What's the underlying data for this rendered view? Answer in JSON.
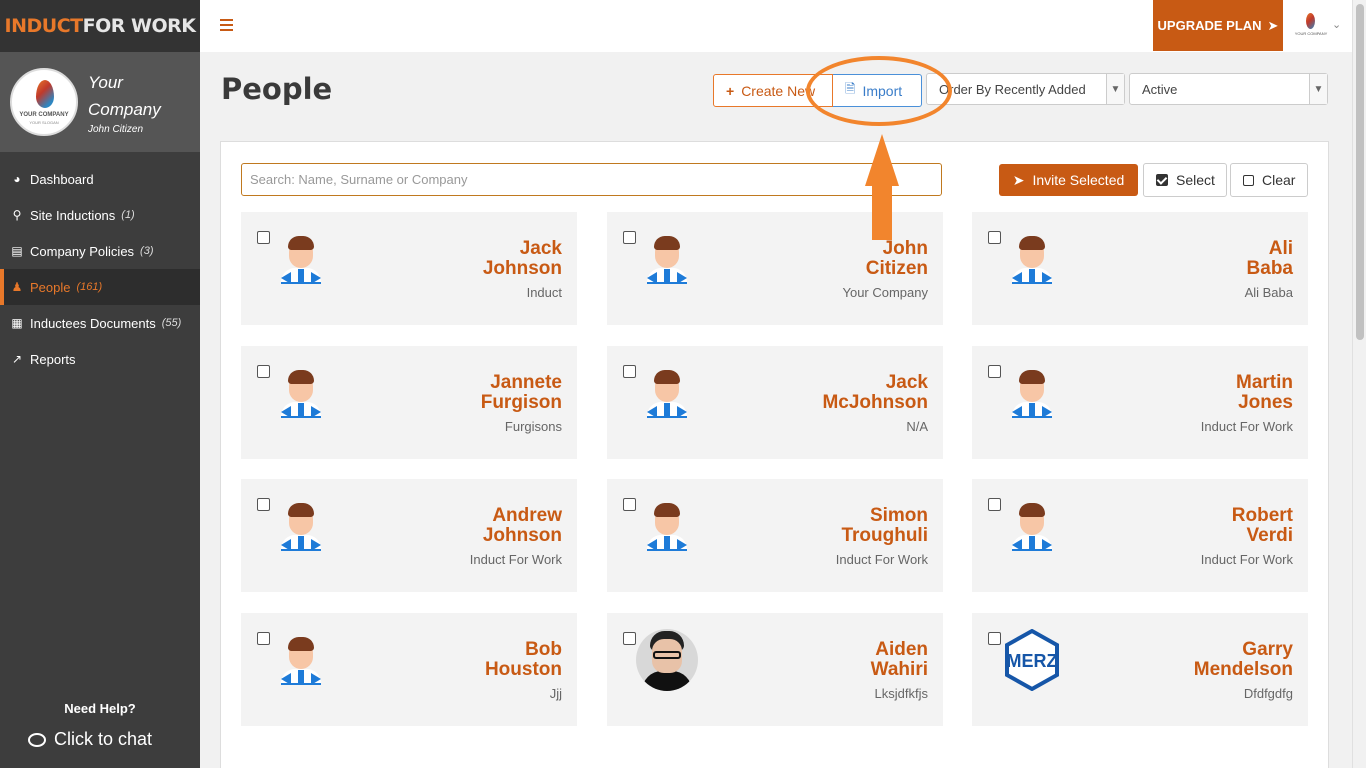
{
  "brand": {
    "part1": "INDUCT",
    "part2": "FOR WORK"
  },
  "profile": {
    "company": "Your Company",
    "user": "John Citizen",
    "logo_text": "YOUR COMPANY",
    "logo_sub": "YOUR SLOGAN"
  },
  "sidebar": {
    "items": [
      {
        "label": "Dashboard",
        "count": "",
        "icon": "dashboard-icon"
      },
      {
        "label": "Site Inductions",
        "count": "(1)",
        "icon": "map-marker-icon"
      },
      {
        "label": "Company Policies",
        "count": "(3)",
        "icon": "book-icon"
      },
      {
        "label": "People",
        "count": "(161)",
        "icon": "users-icon"
      },
      {
        "label": "Inductees Documents",
        "count": "(55)",
        "icon": "document-icon"
      },
      {
        "label": "Reports",
        "count": "",
        "icon": "chart-icon"
      }
    ],
    "help": "Need Help?",
    "chat": "Click to chat"
  },
  "topbar": {
    "upgrade": "UPGRADE PLAN"
  },
  "header": {
    "title": "People",
    "create": "Create New",
    "import": "Import",
    "order_by": "Order By Recently Added",
    "status": "Active"
  },
  "toolbar": {
    "search_placeholder": "Search: Name, Surname or Company",
    "invite": "Invite Selected",
    "select": "Select",
    "clear": "Clear"
  },
  "colors": {
    "accent": "#c85a14",
    "sidebar": "#3d3d3d",
    "annotation": "#f2852d"
  },
  "people": [
    {
      "first": "Jack",
      "last": "Johnson",
      "company": "Induct",
      "avatar": "default"
    },
    {
      "first": "John",
      "last": "Citizen",
      "company": "Your Company",
      "avatar": "default"
    },
    {
      "first": "Ali",
      "last": "Baba",
      "company": "Ali Baba",
      "avatar": "default"
    },
    {
      "first": "Jannete",
      "last": "Furgison",
      "company": "Furgisons",
      "avatar": "default"
    },
    {
      "first": "Jack",
      "last": "McJohnson",
      "company": "N/A",
      "avatar": "default"
    },
    {
      "first": "Martin",
      "last": "Jones",
      "company": "Induct For Work",
      "avatar": "default"
    },
    {
      "first": "Andrew",
      "last": "Johnson",
      "company": "Induct For Work",
      "avatar": "default"
    },
    {
      "first": "Simon",
      "last": "Troughuli",
      "company": "Induct For Work",
      "avatar": "default"
    },
    {
      "first": "Robert",
      "last": "Verdi",
      "company": "Induct For Work",
      "avatar": "default"
    },
    {
      "first": "Bob",
      "last": "Houston",
      "company": "Jjj",
      "avatar": "default"
    },
    {
      "first": "Aiden",
      "last": "Wahiri",
      "company": "Lksjdfkfjs",
      "avatar": "photo"
    },
    {
      "first": "Garry",
      "last": "Mendelson",
      "company": "Dfdfgdfg",
      "avatar": "merz",
      "logo_text": "MERZ"
    }
  ]
}
